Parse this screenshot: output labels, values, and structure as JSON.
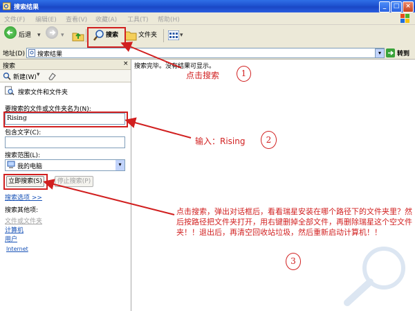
{
  "window": {
    "title": "搜索结果"
  },
  "menu": [
    "文件(F)",
    "编辑(E)",
    "查看(V)",
    "收藏(A)",
    "工具(T)",
    "帮助(H)"
  ],
  "toolbar": {
    "back": "后退",
    "search": "搜索",
    "folders": "文件夹"
  },
  "address": {
    "label": "地址(D)",
    "value": "搜索结果",
    "go": "转到"
  },
  "left": {
    "header": "搜索",
    "new_label": "新建(W)",
    "section_title": "搜索文件和文件夹",
    "name_label": "要搜索的文件或文件夹名为(N):",
    "name_value": "Rising",
    "contains_label": "包含文字(C):",
    "contains_value": "",
    "lookin_label": "搜索范围(L):",
    "lookin_value": "我的电脑",
    "search_now": "立即搜索(S)",
    "stop_search": "停止搜索(P)",
    "options": "搜索选项 >>",
    "other_places": "搜索其他项:",
    "other_items": [
      "文件或文件夹",
      "计算机",
      "用户"
    ],
    "internet": "Internet"
  },
  "results": {
    "status": "搜索完毕。没有结果可显示。"
  },
  "annotations": {
    "step1": "点击搜索",
    "step2": "输入：Rising",
    "step3": "点击搜索，弹出对话框后，看看瑞星安装在哪个路径下的文件夹里？然后按路径把文件夹打开，用右键删掉全部文件，再删除瑞星这个空文件夹！！退出后，再清空回收站垃圾，然后重新启动计算机！！",
    "num1": "1",
    "num2": "2",
    "num3": "3"
  }
}
